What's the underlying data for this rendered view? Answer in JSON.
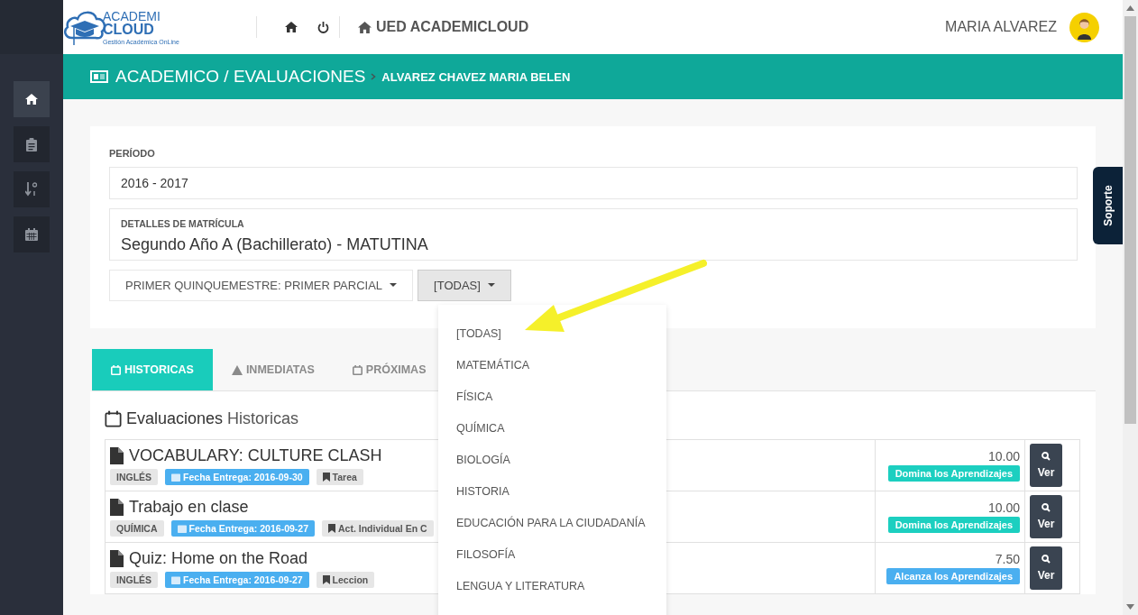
{
  "logo": {
    "line1": "ACADEMI",
    "line2": "CLOUD",
    "tagline": "Gestión Académica OnLine"
  },
  "topbar": {
    "school": "UED ACADEMICLOUD",
    "user": "MARIA ALVAREZ"
  },
  "sidebar": {
    "items": [
      {
        "kind": "home",
        "selected": true
      },
      {
        "kind": "clipboard",
        "selected": false
      },
      {
        "kind": "sort",
        "selected": false
      },
      {
        "kind": "calendar",
        "selected": false
      }
    ]
  },
  "header": {
    "section": "ACADEMICO / EVALUACIONES",
    "student": "ALVAREZ CHAVEZ MARIA BELEN"
  },
  "period": {
    "label": "PERÍODO",
    "value": "2016 - 2017"
  },
  "enrollment": {
    "label": "DETALLES DE MATRÍCULA",
    "value": "Segundo Año A (Bachillerato) - MATUTINA"
  },
  "filters": [
    {
      "label": "PRIMER QUINQUEMESTRE: PRIMER PARCIAL",
      "expanded": false
    },
    {
      "label": "[TODAS]",
      "expanded": true
    }
  ],
  "dropdown": {
    "items": [
      "[TODAS]",
      "MATEMÁTICA",
      "FÍSICA",
      "QUÍMICA",
      "BIOLOGÍA",
      "HISTORIA",
      "EDUCACIÓN PARA LA CIUDADANÍA",
      "FILOSOFÍA",
      "LENGUA Y LITERATURA"
    ]
  },
  "tabs": [
    {
      "label": "HISTORICAS",
      "kind": "calendar",
      "selected": true
    },
    {
      "label": "INMEDIATAS",
      "kind": "warning",
      "selected": false
    },
    {
      "label": "PRÓXIMAS",
      "kind": "calendar",
      "selected": false
    }
  ],
  "section_title": {
    "main": "Evaluaciones",
    "sub": "Historicas"
  },
  "evaluations": [
    {
      "title": "VOCABULARY: CULTURE CLASH",
      "subject": "INGLÉS",
      "due": "Fecha Entrega: 2016-09-30",
      "type": "Tarea",
      "score": "10.00",
      "status": "Domina los Aprendizajes",
      "color": "#1ccfc0",
      "action": "Ver"
    },
    {
      "title": "Trabajo en clase",
      "subject": "QUÍMICA",
      "due": "Fecha Entrega: 2016-09-27",
      "type": "Act. Individual En C",
      "score": "10.00",
      "status": "Domina los Aprendizajes",
      "color": "#1ccfc0",
      "action": "Ver"
    },
    {
      "title": "Quiz: Home on the Road",
      "subject": "INGLÉS",
      "due": "Fecha Entrega: 2016-09-27",
      "type": "Leccion",
      "score": "7.50",
      "status": "Alcanza los Aprendizajes",
      "color": "#4aaff0",
      "action": "Ver"
    }
  ],
  "support_tab": "Soporte"
}
